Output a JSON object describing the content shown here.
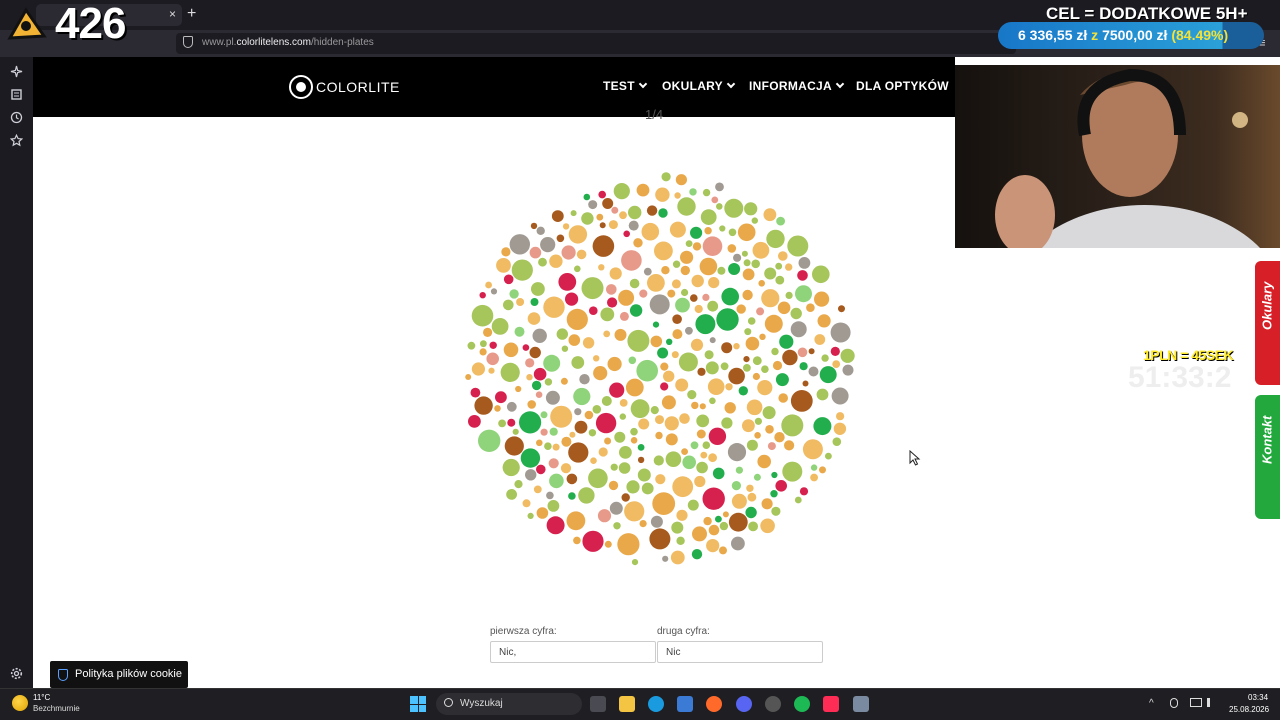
{
  "browser": {
    "tab_close": "×",
    "new_tab": "+",
    "url_prefix": "www.pl.",
    "url_domain": "colorlitelens.com",
    "url_path": "/hidden-plates",
    "more": "≡"
  },
  "site": {
    "logo_text": "COLORLITE",
    "nav": [
      {
        "label": "TEST"
      },
      {
        "label": "OKULARY"
      },
      {
        "label": "INFORMACJA"
      },
      {
        "label": "DLA OPTYKÓW"
      }
    ],
    "plate_counter": "1/4",
    "plate_colors": {
      "orange": "#e9a94a",
      "light_orange": "#f0bb62",
      "green": "#a6c55a",
      "light_green": "#8fd47a",
      "dark_green": "#23ae4e",
      "red": "#d6204e",
      "pink": "#e89a8a",
      "gray": "#a09a92",
      "brown": "#a65a1e"
    },
    "form": {
      "first_label": "pierwsza cyfra:",
      "first_value": "Nic,",
      "second_label": "druga cyfra:",
      "second_value": "Nic"
    },
    "side_tabs": [
      {
        "label": "Okulary",
        "color": "#d61f26"
      },
      {
        "label": "Kontakt",
        "color": "#22a83c"
      }
    ],
    "cookie_text": "Polityka plików cookie"
  },
  "overlay": {
    "count": "426",
    "goal_title": "CEL = DODATKOWE 5H+",
    "goal_current": "6 336,55 zł",
    "goal_of": "z",
    "goal_target": "7500,00 zł",
    "goal_percent": "(84.49%)",
    "goal_progress": 0.8449,
    "rate": "1PLN = 45SEK",
    "timer": "51:33:2"
  },
  "taskbar": {
    "weather_temp": "11°C",
    "weather_desc": "Bezchmurnie",
    "search_placeholder": "Wyszukaj",
    "time": "03:34",
    "date": "25.08.2026"
  }
}
